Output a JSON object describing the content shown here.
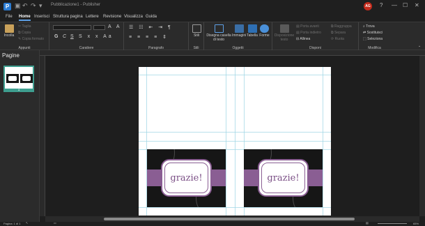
{
  "titlebar": {
    "doc_title": "Pubblicazione1 - Publisher",
    "avatar_initials": "AG",
    "help": "?",
    "minimize": "—",
    "maximize": "☐",
    "close": "✕"
  },
  "menu": {
    "tabs": [
      "File",
      "Home",
      "Inserisci",
      "Struttura pagina",
      "Lettere",
      "Revisione",
      "Visualizza",
      "Guida"
    ],
    "active": "Home"
  },
  "ribbon": {
    "clipboard": {
      "paste": "Incolla",
      "cut": "Taglia",
      "copy": "Copia",
      "format_painter": "Copia formato",
      "label": "Appunti"
    },
    "font": {
      "bold": "G",
      "italic": "C",
      "underline": "S",
      "label": "Carattere"
    },
    "paragraph": {
      "label": "Paragrafo"
    },
    "styles": {
      "btn": "Stili",
      "label": "Stili"
    },
    "objects": {
      "textbox": "Disegna casella di testo",
      "images": "Immagini",
      "table": "Tabella",
      "shapes": "Forme",
      "label": "Oggetti"
    },
    "arrange": {
      "wrap": "Disposizione testo",
      "bring_forward": "Porta avanti",
      "send_backward": "Porta indietro",
      "align": "Allinea",
      "group": "Raggruppa",
      "ungroup": "Separa",
      "rotate": "Ruota",
      "label": "Disponi"
    },
    "editing": {
      "find": "Trova",
      "replace": "Sostituisci",
      "select": "Seleziona",
      "label": "Modifica"
    }
  },
  "pages_panel": {
    "title": "Pagine",
    "page_number": "1"
  },
  "cards": [
    {
      "text": "grazie!"
    },
    {
      "text": "grazie!"
    }
  ],
  "status": {
    "page": "Pagina: 1 di 1",
    "zoom": "65%"
  },
  "colors": {
    "accent": "#5ea0e6",
    "card_purple": "#8a5e93",
    "thumb_teal": "#3e9e8f"
  }
}
